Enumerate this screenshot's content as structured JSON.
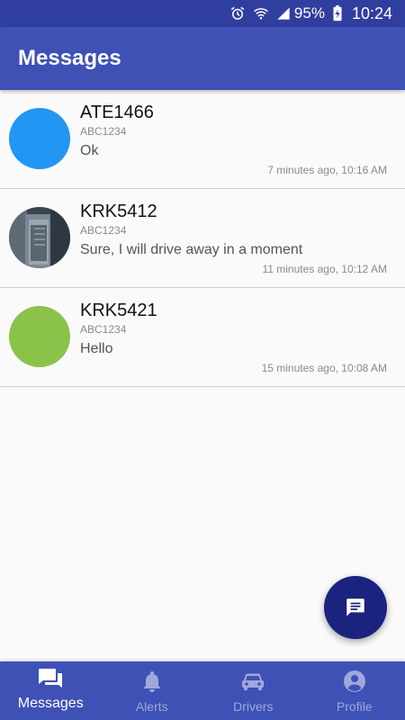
{
  "status_bar": {
    "battery": "95%",
    "time": "10:24"
  },
  "app_bar": {
    "title": "Messages"
  },
  "messages": [
    {
      "name": "ATE1466",
      "sub": "ABC1234",
      "text": "Ok",
      "time": "7 minutes ago, 10:16 AM",
      "avatar_color": "#2196f3"
    },
    {
      "name": "KRK5412",
      "sub": "ABC1234",
      "text": "Sure, I will drive away in a moment",
      "time": "11 minutes ago, 10:12 AM",
      "avatar_color": "photo"
    },
    {
      "name": "KRK5421",
      "sub": "ABC1234",
      "text": "Hello",
      "time": "15 minutes ago, 10:08 AM",
      "avatar_color": "#8bc34a"
    }
  ],
  "fab": {
    "icon": "message-icon"
  },
  "bottom_nav": {
    "items": [
      {
        "label": "Messages",
        "icon": "messages-icon",
        "active": true
      },
      {
        "label": "Alerts",
        "icon": "bell-icon",
        "active": false
      },
      {
        "label": "Drivers",
        "icon": "car-icon",
        "active": false
      },
      {
        "label": "Profile",
        "icon": "account-circle-icon",
        "active": false
      }
    ]
  },
  "colors": {
    "primary": "#3f51b5",
    "primary_dark": "#303f9f",
    "fab": "#1a237e"
  }
}
